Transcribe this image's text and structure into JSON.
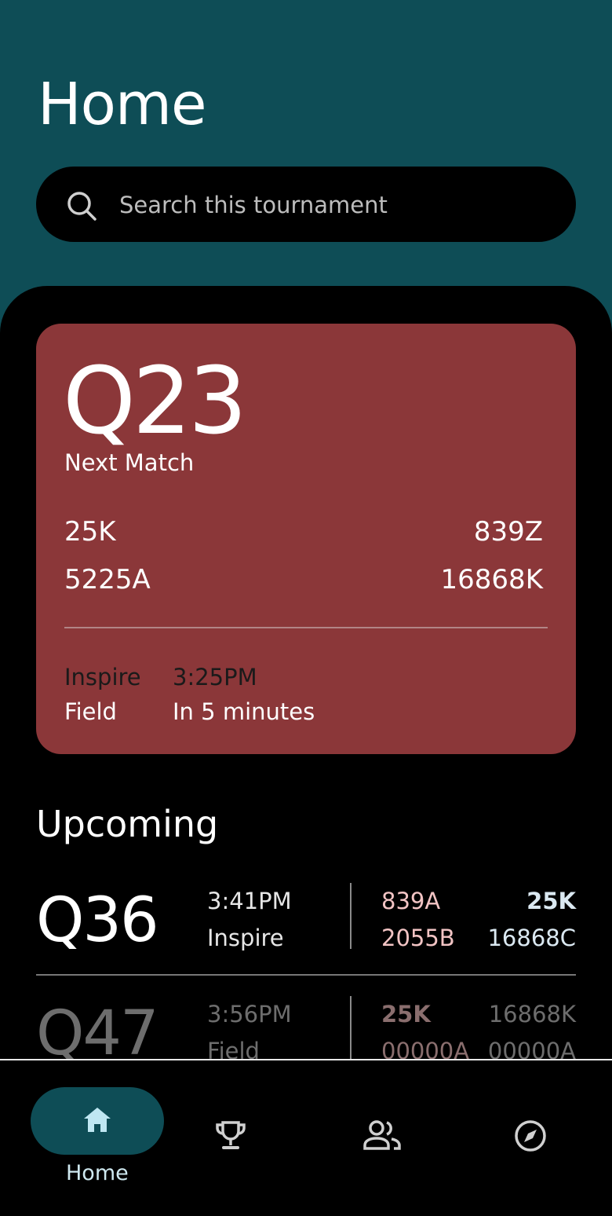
{
  "header": {
    "title": "Home",
    "search_placeholder": "Search this tournament"
  },
  "next_match": {
    "code": "Q23",
    "label": "Next Match",
    "left_teams": [
      "25K",
      "5225A"
    ],
    "right_teams": [
      "839Z",
      "16868K"
    ],
    "field_lines": [
      "Inspire",
      "Field"
    ],
    "time_lines": [
      "3:25PM",
      "In 5 minutes"
    ],
    "color": "#8b3739"
  },
  "upcoming": {
    "title": "Upcoming",
    "matches": [
      {
        "code": "Q36",
        "time": "3:41PM",
        "field": "Inspire",
        "teams": [
          "839A",
          "25K",
          "2055B",
          "16868C"
        ]
      },
      {
        "code": "Q47",
        "time": "3:56PM",
        "field": "Field",
        "teams": [
          "25K",
          "16868K",
          "00000A",
          "00000A"
        ]
      }
    ]
  },
  "nav": {
    "items": [
      {
        "label": "Home",
        "icon": "home-icon",
        "active": true
      },
      {
        "label": "",
        "icon": "trophy-icon",
        "active": false
      },
      {
        "label": "",
        "icon": "people-icon",
        "active": false
      },
      {
        "label": "",
        "icon": "compass-icon",
        "active": false
      }
    ]
  },
  "colors": {
    "header_bg": "#0e4d56",
    "main_bg": "#000000",
    "accent": "#0e4d56"
  }
}
